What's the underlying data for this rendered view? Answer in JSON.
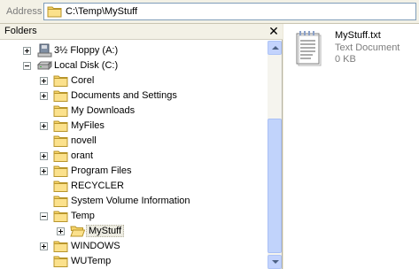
{
  "address_bar": {
    "label": "Address",
    "path": "C:\\Temp\\MyStuff"
  },
  "folders_pane": {
    "title": "Folders",
    "close_glyph": "✕",
    "items": [
      {
        "label": "3½ Floppy (A:)",
        "icon": "floppy-drive-icon",
        "expander": "plus"
      },
      {
        "label": "Local Disk (C:)",
        "icon": "hard-drive-icon",
        "expander": "minus"
      },
      {
        "label": "Corel",
        "icon": "folder-icon",
        "expander": "plus"
      },
      {
        "label": "Documents and Settings",
        "icon": "folder-icon",
        "expander": "plus"
      },
      {
        "label": "My Downloads",
        "icon": "folder-icon",
        "expander": "none"
      },
      {
        "label": "MyFiles",
        "icon": "folder-icon",
        "expander": "plus"
      },
      {
        "label": "novell",
        "icon": "folder-icon",
        "expander": "none"
      },
      {
        "label": "orant",
        "icon": "folder-icon",
        "expander": "plus"
      },
      {
        "label": "Program Files",
        "icon": "folder-icon",
        "expander": "plus"
      },
      {
        "label": "RECYCLER",
        "icon": "folder-icon",
        "expander": "none"
      },
      {
        "label": "System Volume Information",
        "icon": "folder-icon",
        "expander": "none"
      },
      {
        "label": "Temp",
        "icon": "folder-icon",
        "expander": "minus"
      },
      {
        "label": "MyStuff",
        "icon": "open-folder-icon",
        "expander": "plus",
        "selected": true
      },
      {
        "label": "WINDOWS",
        "icon": "folder-icon",
        "expander": "plus"
      },
      {
        "label": "WUTemp",
        "icon": "folder-icon",
        "expander": "none"
      }
    ]
  },
  "file_list": {
    "items": [
      {
        "name": "MyStuff.txt",
        "type": "Text Document",
        "size": "0 KB",
        "icon": "text-document-icon"
      }
    ]
  },
  "colors": {
    "chrome": "#ece9d8",
    "folder_yellow": "#f6d46b",
    "scrollbar_blue": "#c3d3fd"
  }
}
